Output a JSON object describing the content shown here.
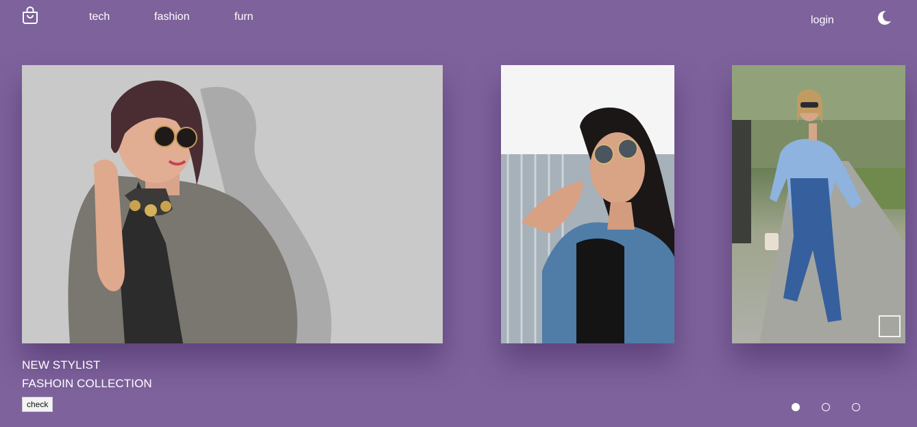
{
  "nav": {
    "logo_icon": "shopping-bag-icon",
    "links": [
      "tech",
      "fashion",
      "furn"
    ],
    "login_label": "login",
    "theme_icon": "moon-icon"
  },
  "slider": {
    "slides": [
      {
        "image": "woman-gray-trench-sunglasses-photo"
      },
      {
        "image": "woman-denim-jacket-sunglasses-photo"
      },
      {
        "image": "woman-blue-shirt-jeans-street-photo"
      }
    ],
    "caption_line1": "NEW STYLIST",
    "caption_line2": "FASHOIN COLLECTION",
    "button_label": "check",
    "dot_count": 3,
    "active_dot": 1
  },
  "colors": {
    "background": "#7e629c",
    "text": "#ffffff"
  }
}
